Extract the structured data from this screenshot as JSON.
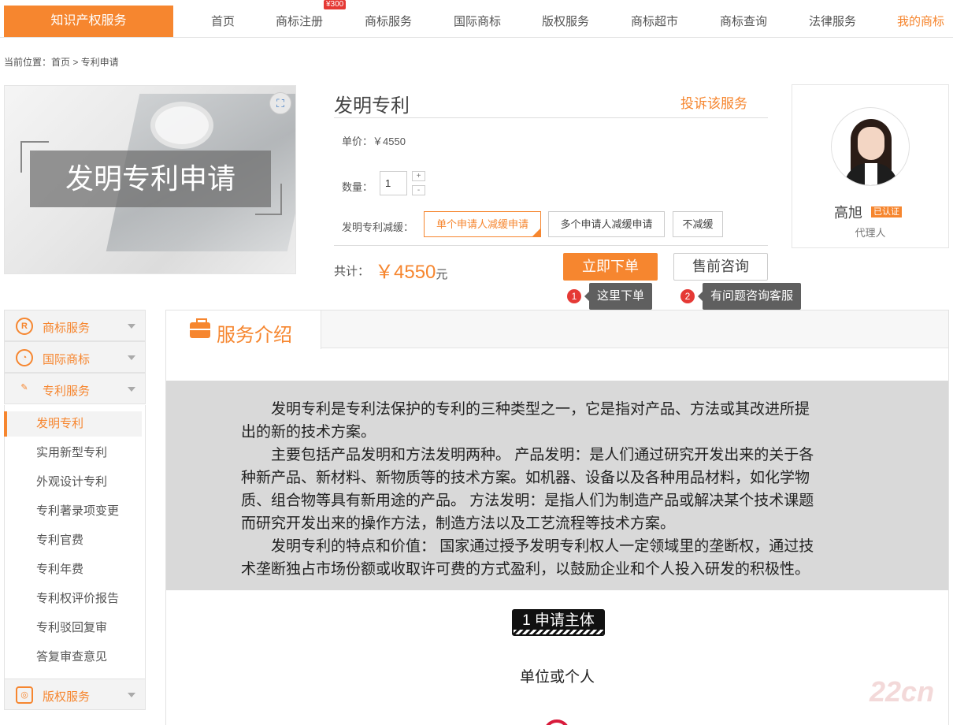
{
  "nav": {
    "brand": "知识产权服务",
    "badge": "¥300",
    "items": [
      "首页",
      "商标注册",
      "商标服务",
      "国际商标",
      "版权服务",
      "商标超市",
      "商标查询",
      "法律服务",
      "我的商标"
    ]
  },
  "breadcrumb": "当前位置：首页 > 专利申请",
  "product": {
    "image_label": "发明专利申请",
    "title": "发明专利",
    "complain": "投诉该服务",
    "price_label": "单价：",
    "price": "￥4550",
    "qty_label": "数量：",
    "qty_value": "1",
    "qty_plus": "+",
    "qty_minus": "-",
    "reduce_label": "发明专利减缓：",
    "options": [
      "单个申请人减缓申请",
      "多个申请人减缓申请",
      "不减缓"
    ],
    "total_label": "共计：",
    "total_value": "￥4550",
    "total_unit": "元",
    "order_btn": "立即下单",
    "consult_btn": "售前咨询",
    "tip1_num": "1",
    "tip1": "这里下单",
    "tip2_num": "2",
    "tip2": "有问题咨询客服"
  },
  "agent": {
    "name": "高旭",
    "badge": "已认证",
    "role": "代理人"
  },
  "sidebar": {
    "groups": [
      {
        "icon": "R",
        "label": "商标服务"
      },
      {
        "icon": "◔",
        "label": "国际商标"
      },
      {
        "icon": "✎",
        "label": "专利服务"
      },
      {
        "icon": "◎",
        "label": "版权服务"
      }
    ],
    "sub_items": [
      "发明专利",
      "实用新型专利",
      "外观设计专利",
      "专利著录项变更",
      "专利官费",
      "专利年费",
      "专利权评价报告",
      "专利驳回复审",
      "答复审查意见"
    ]
  },
  "main": {
    "tab": "服务介绍",
    "para1_line1": "发明专利是专利法保护的专利的三种类型之一，它是指对产品、方法或其改进所提",
    "para1_line2": "出的新的技术方案。",
    "para2_line1": "主要包括产品发明和方法发明两种。 产品发明：是人们通过研究开发出来的关于各",
    "para2_line2": "种新产品、新材料、新物质等的技术方案。如机器、设备以及各种用品材料，如化学物",
    "para2_line3": "质、组合物等具有新用途的产品。 方法发明：是指人们为制造产品或解决某个技术课题",
    "para2_line4": "而研究开发出来的操作方法，制造方法以及工艺流程等技术方案。",
    "para3_line1": "发明专利的特点和价值： 国家通过授予发明专利权人一定领域里的垄断权，通过技",
    "para3_line2": "术垄断独占市场份额或收取许可费的方式盈利，以鼓励企业和个人投入研发的积极性。",
    "section_badge": "1 申请主体",
    "section_text": "单位或个人",
    "watermark": "22cn"
  },
  "colors": {
    "accent": "#f6862f",
    "badge_red": "#e53935",
    "intro_bg": "#d9d9d9"
  }
}
